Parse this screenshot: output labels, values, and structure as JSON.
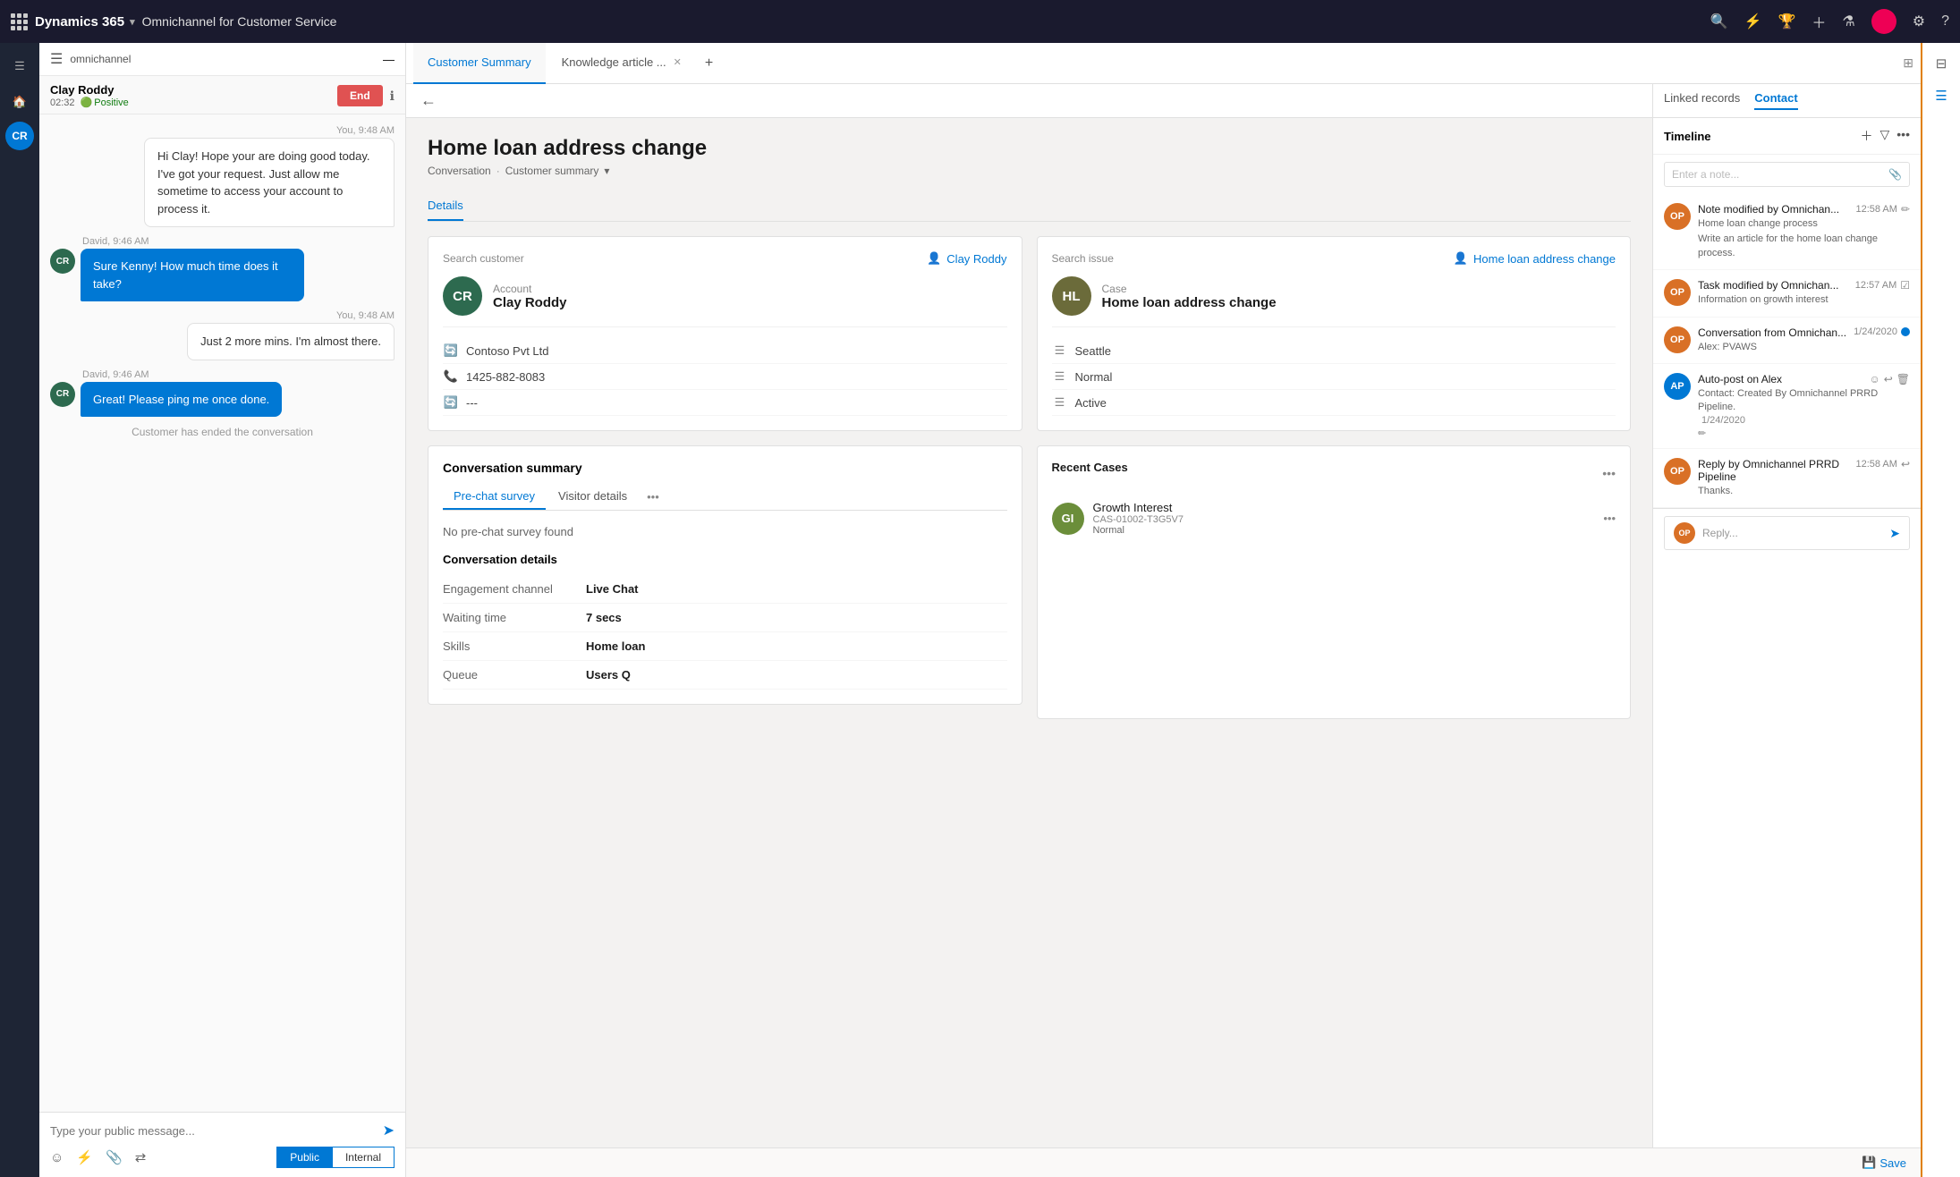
{
  "app": {
    "brand": "Dynamics 365",
    "app_name": "Omnichannel for Customer Service"
  },
  "left_nav": {
    "items": [
      "home",
      "chat",
      "contacts"
    ]
  },
  "conversation": {
    "channel_label": "omnichannel",
    "customer_name": "Clay Roddy",
    "time": "02:32",
    "sentiment": "Positive",
    "end_button": "End",
    "messages": [
      {
        "sender": "You",
        "time": "9:48 AM",
        "text": "Hi Clay! Hope your are doing good today. I've got your request. Just allow me sometime to access your account to process it.",
        "type": "agent"
      },
      {
        "sender": "David",
        "time": "9:46 AM",
        "text": "Sure Kenny! How much time does it take?",
        "type": "customer"
      },
      {
        "sender": "You",
        "time": "9:48 AM",
        "text": "Just 2 more mins. I'm almost there.",
        "type": "agent"
      },
      {
        "sender": "David",
        "time": "9:46 AM",
        "text": "Great! Please ping me once done.",
        "type": "customer"
      }
    ],
    "system_message": "Customer has ended the conversation",
    "input_placeholder": "Type your public message...",
    "mode_public": "Public",
    "mode_internal": "Internal"
  },
  "tabs": {
    "customer_summary": "Customer Summary",
    "knowledge_article": "Knowledge article ...",
    "add_tab": "+"
  },
  "page": {
    "title": "Home loan address change",
    "breadcrumb_conv": "Conversation",
    "breadcrumb_summary": "Customer summary",
    "details_tab": "Details"
  },
  "customer_card": {
    "search_label": "Search customer",
    "search_value": "Clay Roddy",
    "avatar_initials": "CR",
    "avatar_color": "#2d6a4f",
    "account_label": "Account",
    "name": "Clay Roddy",
    "company": "Contoso Pvt Ltd",
    "phone": "1425-882-8083",
    "extra": "---"
  },
  "case_card": {
    "search_label": "Search issue",
    "search_value": "Home loan address change",
    "avatar_initials": "HL",
    "avatar_color": "#6b6b3a",
    "case_label": "Case",
    "case_name": "Home loan address change",
    "location": "Seattle",
    "priority": "Normal",
    "status": "Active"
  },
  "conversation_summary": {
    "title": "Conversation summary",
    "tab_pre_chat": "Pre-chat survey",
    "tab_visitor": "Visitor details",
    "no_survey_text": "No pre-chat survey found",
    "details_title": "Conversation details",
    "fields": [
      {
        "label": "Engagement channel",
        "value": "Live Chat"
      },
      {
        "label": "Waiting time",
        "value": "7 secs"
      },
      {
        "label": "Skills",
        "value": "Home loan"
      },
      {
        "label": "Queue",
        "value": "Users Q"
      }
    ]
  },
  "recent_cases": {
    "title": "Recent Cases",
    "cases": [
      {
        "initials": "GI",
        "color": "#6b8e3a",
        "name": "Growth Interest",
        "id": "CAS-01002-T3G5V7",
        "priority": "Normal"
      }
    ]
  },
  "right_panel": {
    "tab_linked": "Linked records",
    "tab_contact": "Contact",
    "timeline_title": "Timeline",
    "note_placeholder": "Enter a note...",
    "items": [
      {
        "avatar": "OP",
        "avatar_color": "#d97026",
        "title": "Note modified by Omnichan...",
        "time": "12:58 AM",
        "desc1": "Home loan change process",
        "desc2": "Write an article for the home loan change process.",
        "icon": "edit"
      },
      {
        "avatar": "OP",
        "avatar_color": "#d97026",
        "title": "Task modified by Omnichan...",
        "time": "12:57 AM",
        "desc1": "Information on growth interest",
        "desc2": "",
        "icon": "checkbox"
      },
      {
        "avatar": "OP",
        "avatar_color": "#d97026",
        "title": "Conversation from Omnichan...",
        "time": "1/24/2020",
        "desc1": "Alex: PVAWS",
        "desc2": "",
        "icon": "dot-blue"
      },
      {
        "avatar": "AP",
        "avatar_color": "#0078d4",
        "title": "Auto-post on Alex",
        "time": "1/24/2020",
        "desc1": "Contact: Created By Omnichannel PRRD Pipeline.",
        "desc2": "",
        "icon": "edit"
      },
      {
        "avatar": "OP",
        "avatar_color": "#d97026",
        "title": "Reply by Omnichannel PRRD Pipeline",
        "time": "12:58 AM",
        "desc1": "Thanks.",
        "desc2": "",
        "icon": "reply"
      }
    ],
    "reply_placeholder": "Reply..."
  },
  "save": "Save"
}
